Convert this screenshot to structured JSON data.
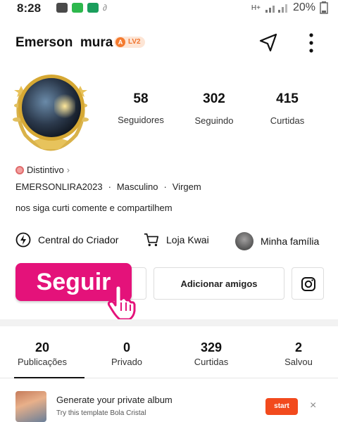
{
  "status_bar": {
    "time": "8:28",
    "network": "H+",
    "battery": "20%"
  },
  "profile": {
    "name": "Emerson  mura",
    "level_badge": "LV2",
    "level_icon_text": "A"
  },
  "stats": [
    {
      "value": "58",
      "label": "Seguidores"
    },
    {
      "value": "302",
      "label": "Seguindo"
    },
    {
      "value": "415",
      "label": "Curtidas"
    }
  ],
  "badge_link": {
    "label": "Distintivo",
    "chevron": "›"
  },
  "info": {
    "handle": "EMERSONLIRA2023",
    "sep": "·",
    "gender": "Masculino",
    "sign": "Virgem"
  },
  "bio": "nos siga curti comente e compartilhem",
  "quick_links": [
    {
      "label": "Central do Criador",
      "icon": "lightning-circle-icon"
    },
    {
      "label": "Loja Kwai",
      "icon": "cart-icon"
    },
    {
      "label": "Minha família",
      "icon": "family-avatar-icon"
    }
  ],
  "actions": {
    "follow": "Seguir",
    "add_friends": "Adicionar amigos",
    "instagram_icon": "instagram-icon"
  },
  "tabs": [
    {
      "value": "20",
      "label": "Publicações",
      "active": true
    },
    {
      "value": "0",
      "label": "Privado",
      "active": false
    },
    {
      "value": "329",
      "label": "Curtidas",
      "active": false
    },
    {
      "value": "2",
      "label": "Salvou",
      "active": false
    }
  ],
  "promo": {
    "title": "Generate your private album",
    "subtitle": "Try this template Bola Cristal",
    "button": "start",
    "close": "×"
  },
  "colors": {
    "accent_pink": "#e4127a",
    "level_orange": "#f47a2e",
    "start_orange": "#f24a1d",
    "avatar_gold": "#d6a833"
  }
}
